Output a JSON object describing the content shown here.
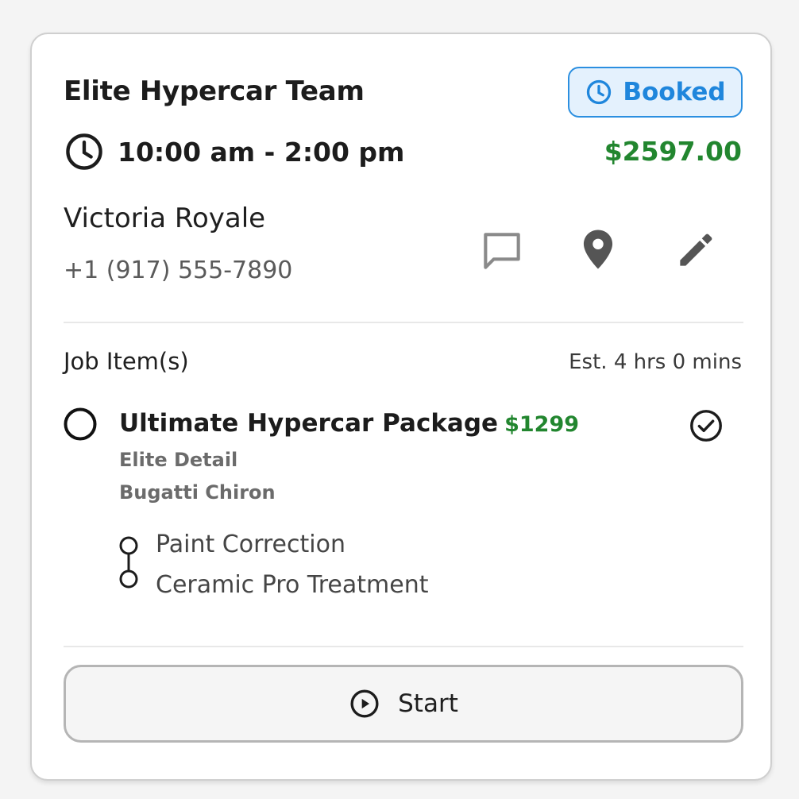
{
  "job": {
    "team_name": "Elite Hypercar Team",
    "status": "Booked",
    "time_range": "10:00 am - 2:00 pm",
    "total_price": "$2597.00"
  },
  "customer": {
    "name": "Victoria Royale",
    "phone": "+1 (917) 555-7890"
  },
  "actions": {
    "icons": [
      "chat-icon",
      "location-pin-icon",
      "edit-pencil-icon"
    ]
  },
  "job_items": {
    "section_title": "Job Item(s)",
    "estimate": "Est. 4 hrs 0 mins",
    "items": [
      {
        "name": "Ultimate Hypercar Package",
        "price": "$1299",
        "package": "Elite Detail",
        "vehicle": "Bugatti Chiron",
        "services": [
          "Paint Correction",
          "Ceramic Pro Treatment"
        ]
      }
    ]
  },
  "start_button": {
    "label": "Start"
  },
  "colors": {
    "status_blue": "#1f86dc",
    "price_green": "#22862f"
  }
}
